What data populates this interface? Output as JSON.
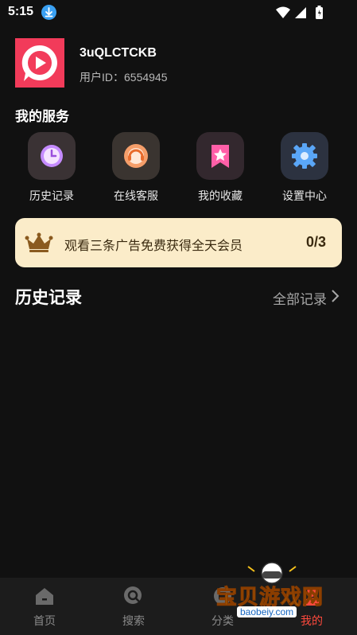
{
  "status_bar": {
    "time": "5:15",
    "icons": [
      "download-icon",
      "wifi-icon",
      "signal-icon",
      "battery-icon"
    ]
  },
  "profile": {
    "username": "3uQLCTCKB",
    "id_label": "用户ID：",
    "id_value": "6554945"
  },
  "services": {
    "title": "我的服务",
    "items": [
      {
        "label": "历史记录",
        "icon": "clock-icon"
      },
      {
        "label": "在线客服",
        "icon": "support-icon"
      },
      {
        "label": "我的收藏",
        "icon": "bookmark-star-icon"
      },
      {
        "label": "设置中心",
        "icon": "gear-icon"
      }
    ]
  },
  "promo": {
    "text": "观看三条广告免费获得全天会员",
    "count": "0/3",
    "icon": "crown-icon"
  },
  "history": {
    "title": "历史记录",
    "all_label": "全部记录"
  },
  "bottom_nav": {
    "items": [
      {
        "label": "首页",
        "icon": "home-icon"
      },
      {
        "label": "搜索",
        "icon": "search-icon"
      },
      {
        "label": "分类",
        "icon": "category-icon"
      },
      {
        "label": "我的",
        "icon": "profile-icon"
      }
    ],
    "active": "我的"
  },
  "watermark": {
    "title": "宝贝游戏网",
    "url": "baobeiy.com"
  },
  "colors": {
    "background": "#111111",
    "brand": "#f23b5a",
    "promo_bg": "#fbecc9",
    "active_nav": "#ff4a3d"
  }
}
